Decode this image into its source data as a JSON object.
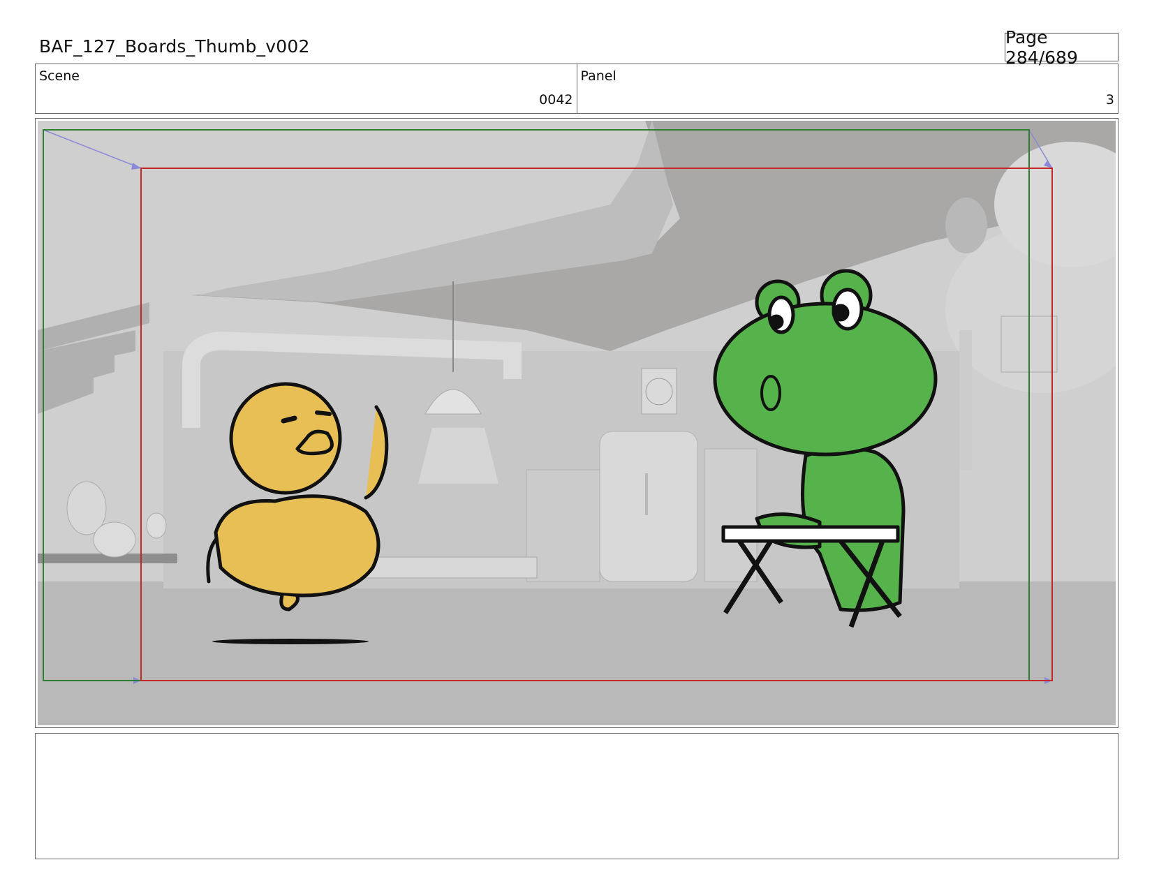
{
  "document": {
    "title": "BAF_127_Boards_Thumb_v002",
    "page_label": "Page 284/689"
  },
  "info": {
    "scene_label": "Scene",
    "scene_value": "0042",
    "panel_label": "Panel",
    "panel_value": "3"
  },
  "colors": {
    "safe_frame": "#2e7d32",
    "camera_frame": "#c62828",
    "move_arrow": "#8a8ad8",
    "chick": "#e8bf55",
    "frog": "#56b24b",
    "background_render": "#c9c9c9"
  },
  "notes": {
    "text": ""
  }
}
